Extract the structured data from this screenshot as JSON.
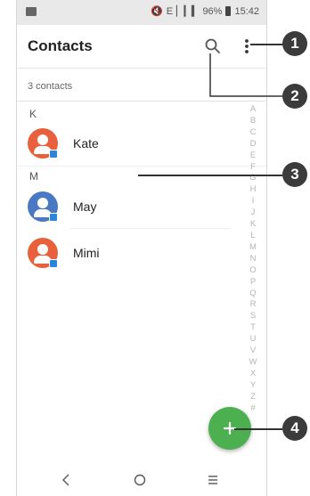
{
  "status_bar": {
    "network": "E",
    "battery_percent": "96%",
    "time": "15:42"
  },
  "header": {
    "title": "Contacts"
  },
  "contacts_count": "3 contacts",
  "sections": [
    {
      "letter": "K",
      "contacts": [
        {
          "name": "Kate",
          "avatar_color": "#e8603c"
        }
      ]
    },
    {
      "letter": "M",
      "contacts": [
        {
          "name": "May",
          "avatar_color": "#4a78c2"
        },
        {
          "name": "Mimi",
          "avatar_color": "#e8603c"
        }
      ]
    }
  ],
  "alphabet": [
    "A",
    "B",
    "C",
    "D",
    "E",
    "F",
    "G",
    "H",
    "I",
    "J",
    "K",
    "L",
    "M",
    "N",
    "O",
    "P",
    "Q",
    "R",
    "S",
    "T",
    "U",
    "V",
    "W",
    "X",
    "Y",
    "Z",
    "#"
  ],
  "fab": {
    "icon": "plus-icon",
    "color": "#4caf50"
  },
  "nav": [
    "back-icon",
    "home-icon",
    "recents-icon"
  ],
  "callouts": [
    "1",
    "2",
    "3",
    "4"
  ]
}
